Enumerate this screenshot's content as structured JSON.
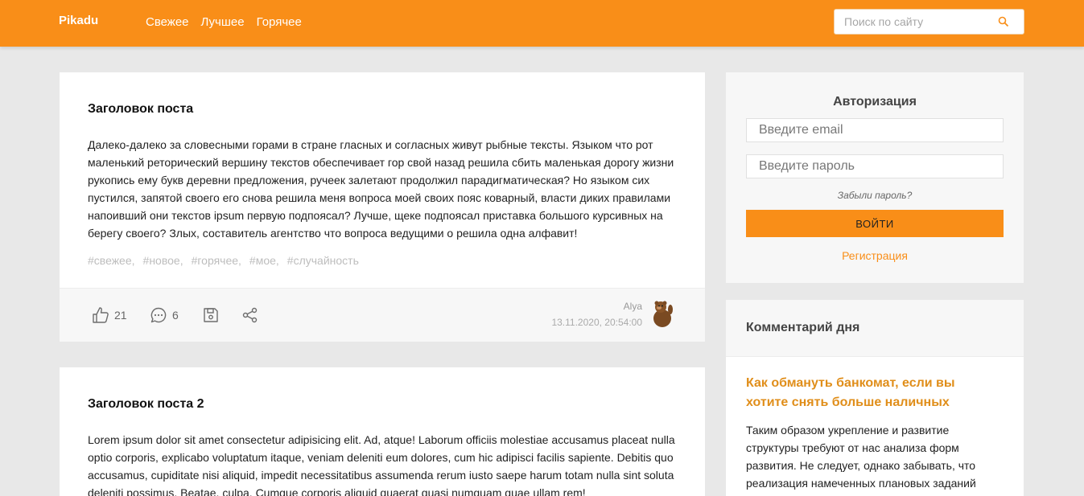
{
  "header": {
    "logo": "Pikadu",
    "nav": [
      "Свежее",
      "Лучшее",
      "Горячее"
    ],
    "search_placeholder": "Поиск по сайту",
    "brand_color": "#f98e18"
  },
  "posts": [
    {
      "title": "Заголовок поста",
      "text": "Далеко-далеко за словесными горами в стране гласных и согласных живут рыбные тексты. Языком что рот маленький реторический вершину текстов обеспечивает гор свой назад решила сбить маленькая дорогу жизни рукопись ему букв деревни предложения, ручеек залетают продолжил парадигматическая? Но языком сих пустился, запятой своего его снова решила меня вопроса моей своих пояс коварный, власти диких правилами напоивший они текстов ipsum первую подпоясал? Лучше, щеке подпоясал приставка большого курсивных на берегу своего? Злых, составитель агентство что вопроса ведущими о решила одна алфавит!",
      "tags": [
        "#свежее,",
        "#новое,",
        "#горячее,",
        "#мое,",
        "#случайность"
      ],
      "likes": "21",
      "comments": "6",
      "author": "Alya",
      "date": "13.11.2020, 20:54:00"
    },
    {
      "title": "Заголовок поста 2",
      "text": "Lorem ipsum dolor sit amet consectetur adipisicing elit. Ad, atque! Laborum officiis molestiae accusamus placeat nulla optio corporis, explicabo voluptatum itaque, veniam deleniti eum dolores, cum hic adipisci facilis sapiente. Debitis quo accusamus, cupiditate nisi aliquid, impedit necessitatibus assumenda rerum iusto saepe harum totam nulla sint soluta deleniti possimus. Beatae, culpa. Cumque corporis aliquid quaerat quasi numquam quae ullam rem!"
    }
  ],
  "auth": {
    "title": "Авторизация",
    "email_placeholder": "Введите email",
    "password_placeholder": "Введите пароль",
    "forgot": "Забыли пароль?",
    "login": "ВОЙТИ",
    "register": "Регистрация"
  },
  "comment_of_day": {
    "heading": "Комментарий дня",
    "title": "Как обмануть банкомат, если вы хотите снять больше наличных",
    "text": "Таким образом укрепление и развитие структуры требуют от нас анализа форм развития. Не следует, однако забывать, что реализация намеченных плановых заданий"
  }
}
